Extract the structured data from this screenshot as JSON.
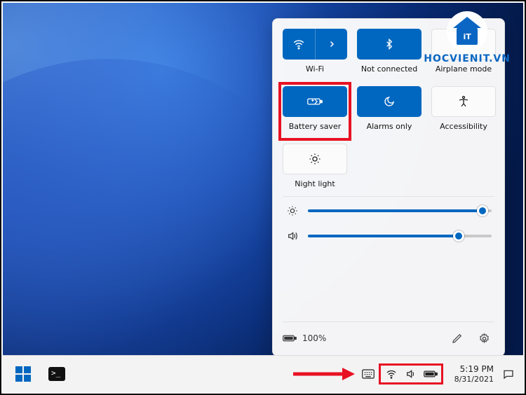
{
  "watermark": {
    "badge_text": "iT",
    "site": "HOCVIENIT.VN"
  },
  "quick_settings": {
    "tiles": {
      "wifi": {
        "label": "Wi-Fi"
      },
      "bluetooth": {
        "label": "Not connected"
      },
      "airplane": {
        "label": "Airplane mode"
      },
      "battery_saver": {
        "label": "Battery saver"
      },
      "focus": {
        "label": "Alarms only"
      },
      "accessibility": {
        "label": "Accessibility"
      },
      "night_light": {
        "label": "Night light"
      }
    },
    "sliders": {
      "brightness_pct": 95,
      "volume_pct": 82
    },
    "footer": {
      "battery_text": "100%"
    }
  },
  "taskbar": {
    "tray": {
      "time": "5:19 PM",
      "date": "8/31/2021"
    }
  },
  "colors": {
    "accent": "#0067c0",
    "highlight": "#e81123"
  }
}
